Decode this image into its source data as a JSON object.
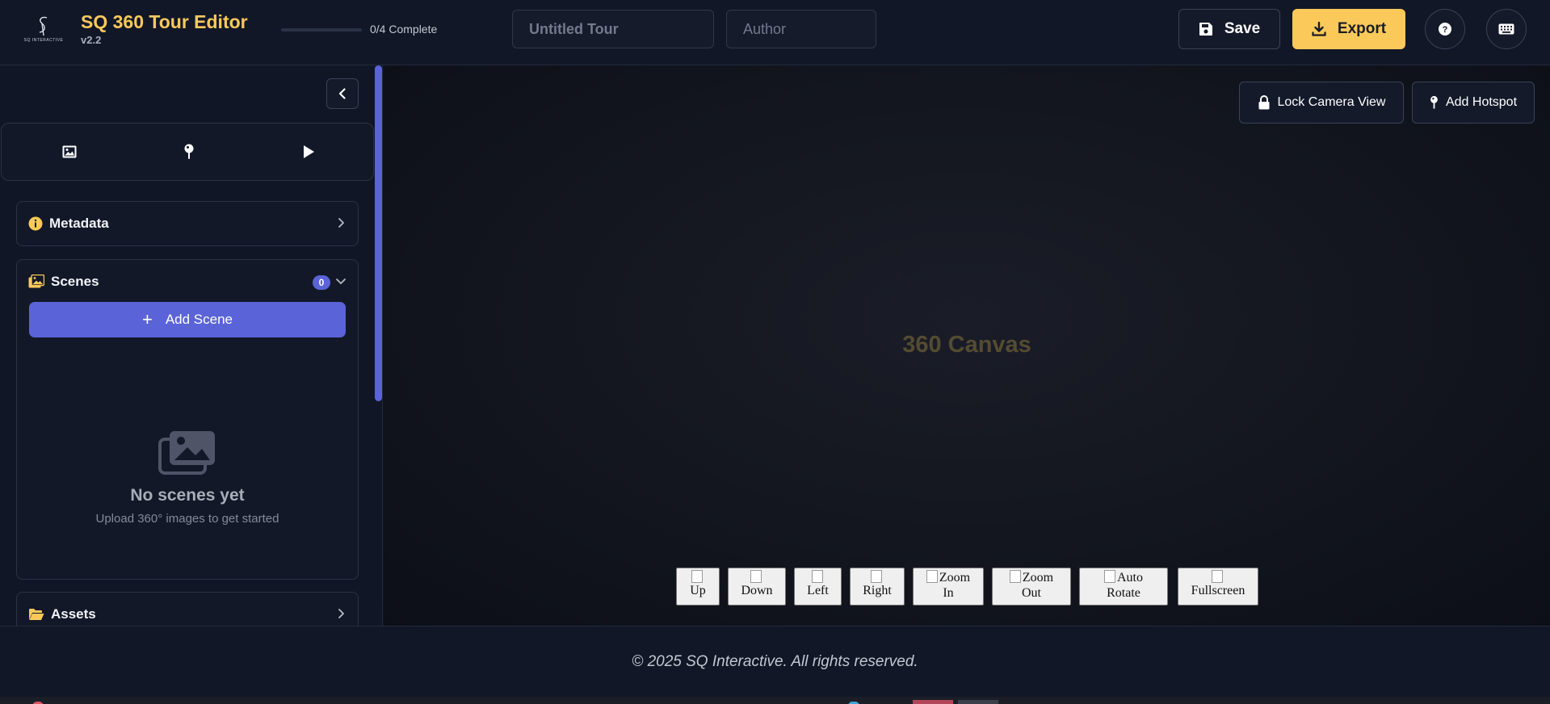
{
  "header": {
    "logo_text": "SQ INTERACTIVE",
    "title": "SQ 360 Tour Editor",
    "version": "v2.2",
    "progress": {
      "completed": 0,
      "total": 4,
      "label": "0/4 Complete"
    },
    "tour_title": {
      "value": "",
      "placeholder": "Untitled Tour"
    },
    "author": {
      "value": "",
      "placeholder": "Author"
    },
    "save_label": "Save",
    "export_label": "Export",
    "help_icon": "question-circle-icon",
    "keyboard_icon": "keyboard-icon"
  },
  "sidebar": {
    "collapse_icon": "chevron-left-icon",
    "tabs": [
      {
        "name": "images",
        "icon": "image-icon"
      },
      {
        "name": "hotspots",
        "icon": "map-pin-icon"
      },
      {
        "name": "preview",
        "icon": "play-icon"
      }
    ],
    "metadata": {
      "title": "Metadata",
      "icon": "info-icon",
      "expanded": false
    },
    "scenes": {
      "title": "Scenes",
      "icon": "images-icon",
      "count": "0",
      "expanded": true,
      "add_label": "Add Scene",
      "empty_title": "No scenes yet",
      "empty_subtitle": "Upload 360° images to get started"
    },
    "assets": {
      "title": "Assets",
      "icon": "folder-open-icon",
      "expanded": false
    }
  },
  "canvas": {
    "label": "360 Canvas",
    "lock_label": "Lock Camera View",
    "hotspot_label": "Add Hotspot",
    "controls": {
      "up": [
        "",
        "Up"
      ],
      "down": [
        "",
        "Down"
      ],
      "left": [
        "",
        "Left"
      ],
      "right": [
        "",
        "Right"
      ],
      "zoom_in": [
        "Zoom",
        "In"
      ],
      "zoom_out": [
        "Zoom",
        "Out"
      ],
      "auto_rotate": [
        "Auto",
        "Rotate"
      ],
      "fullscreen": [
        "",
        "Fullscreen"
      ]
    }
  },
  "footer": {
    "text": "© 2025 SQ Interactive. All rights reserved."
  },
  "colors": {
    "accent": "#fbc95a",
    "primary": "#5b63d8",
    "background": "#0f1320",
    "panel": "#121828"
  }
}
